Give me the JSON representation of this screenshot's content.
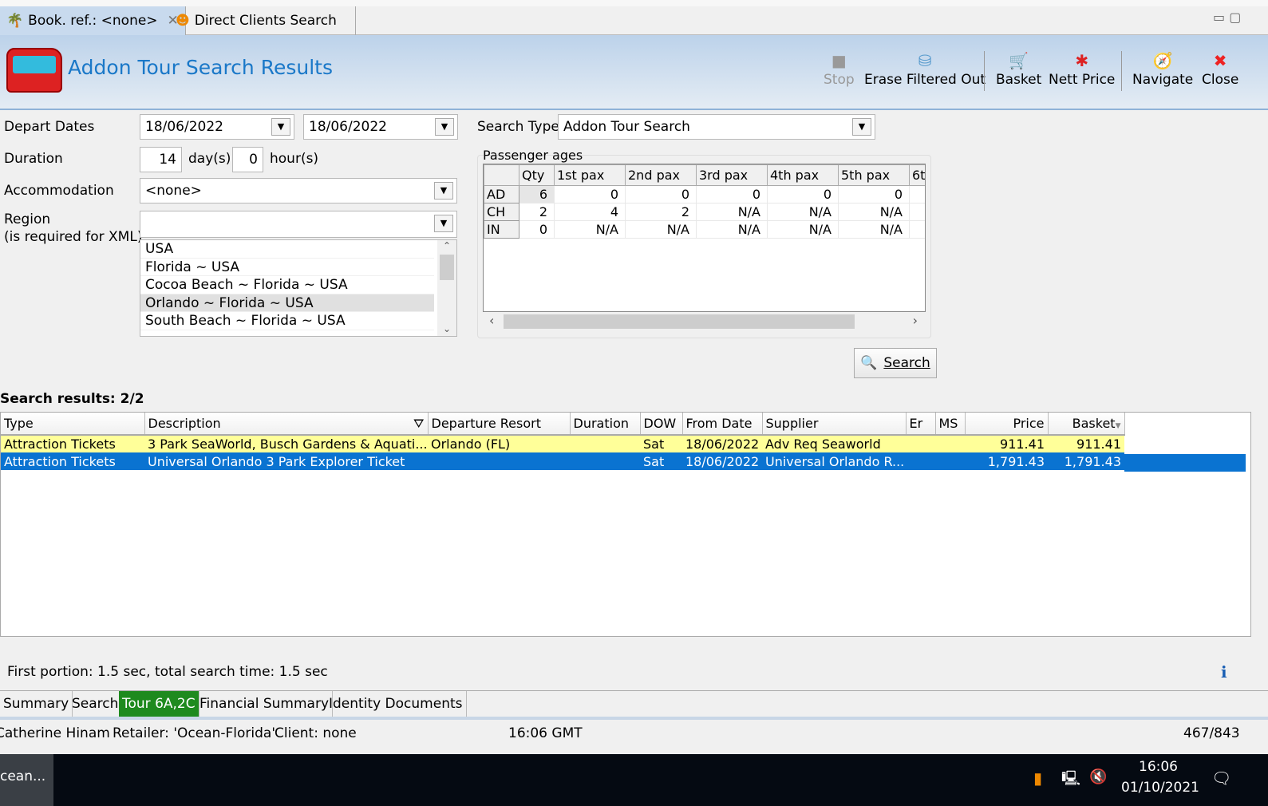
{
  "tabs": [
    {
      "label": "Book. ref.: <none>",
      "icon": "palm-tree-icon"
    },
    {
      "label": "Direct Clients Search",
      "icon": "person-icon"
    }
  ],
  "header": {
    "title": "Addon Tour Search Results",
    "icon": "bus-icon"
  },
  "toolbar": {
    "stop": "Stop",
    "erase": "Erase Filtered Out",
    "basket": "Basket",
    "nett_price": "Nett Price",
    "navigate": "Navigate",
    "close": "Close"
  },
  "form": {
    "depart_dates_label": "Depart Dates",
    "date_from": "18/06/2022",
    "date_to": "18/06/2022",
    "duration_label": "Duration",
    "days": "14",
    "days_unit": "day(s)",
    "hours": "0",
    "hours_unit": "hour(s)",
    "accommodation_label": "Accommodation",
    "accommodation": "<none>",
    "region_label": "Region",
    "region_note": "(is required for XML)",
    "region": "",
    "region_list": [
      "USA",
      "Florida ~ USA",
      "Cocoa Beach ~ Florida ~ USA",
      "Orlando ~ Florida ~ USA",
      "South Beach ~ Florida ~ USA"
    ],
    "search_type_label": "Search Type",
    "search_type": "Addon Tour Search",
    "search_button": "Search"
  },
  "passengers": {
    "title": "Passenger ages",
    "columns": [
      "",
      "Qty",
      "1st pax",
      "2nd pax",
      "3rd pax",
      "4th pax",
      "5th pax",
      "6t"
    ],
    "rows": [
      [
        "AD",
        "6",
        "0",
        "0",
        "0",
        "0",
        "0"
      ],
      [
        "CH",
        "2",
        "4",
        "2",
        "N/A",
        "N/A",
        "N/A"
      ],
      [
        "IN",
        "0",
        "N/A",
        "N/A",
        "N/A",
        "N/A",
        "N/A"
      ]
    ]
  },
  "results": {
    "title": "Search results: 2/2",
    "columns": [
      "Type",
      "Description",
      "Departure Resort",
      "Duration",
      "DOW",
      "From Date",
      "Supplier",
      "Er",
      "MS",
      "Price",
      "Basket"
    ],
    "rows": [
      [
        "Attraction Tickets",
        "3 Park SeaWorld, Busch Gardens & Aquati...",
        "Orlando (FL)",
        "",
        "Sat",
        "18/06/2022",
        "Adv Req Seaworld",
        "",
        "",
        "911.41",
        "911.41"
      ],
      [
        "Attraction Tickets",
        "Universal Orlando 3 Park Explorer Ticket",
        "",
        "",
        "Sat",
        "18/06/2022",
        "Universal Orlando R...",
        "",
        "",
        "1,791.43",
        "1,791.43"
      ]
    ]
  },
  "status": "First portion: 1.5 sec, total search time: 1.5 sec",
  "bottom_tabs": [
    "Summary",
    "Search",
    "Tour 6A,2C",
    "Financial Summary",
    "Identity Documents"
  ],
  "statusbar": {
    "user": "Catherine Hinam",
    "retailer": "Retailer: 'Ocean-Florida'",
    "client": "Client: none",
    "time": "16:06 GMT",
    "count": "467/843"
  },
  "taskbar": {
    "app": "cean...",
    "time": "16:06",
    "date": "01/10/2021"
  },
  "colors": {
    "accent": "#1a78c8",
    "selected_row": "#0a73d1",
    "highlight_row": "#ffff99",
    "active_tab": "#1e8a1e"
  }
}
